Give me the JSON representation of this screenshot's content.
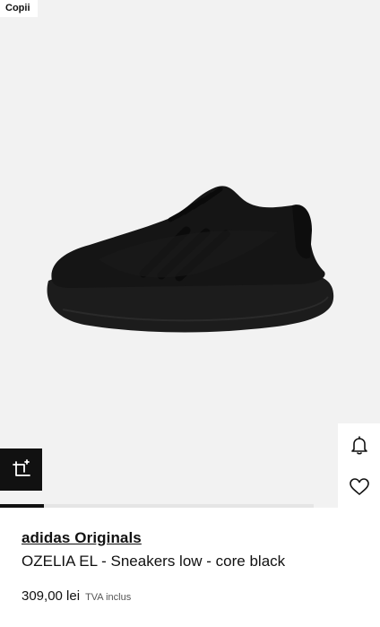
{
  "badge": {
    "label": "Copii"
  },
  "product": {
    "brand": "adidas Originals",
    "name": "OZELIA EL - Sneakers low - core black",
    "price": "309,00 lei",
    "vat_note": "TVA inclus"
  },
  "icons": {
    "share": "share-crop-icon",
    "notify": "bell-icon",
    "wishlist": "heart-icon"
  },
  "gallery": {
    "progress": 0.14
  },
  "colors": {
    "background": "#f2f2f2",
    "accent": "#111111"
  }
}
